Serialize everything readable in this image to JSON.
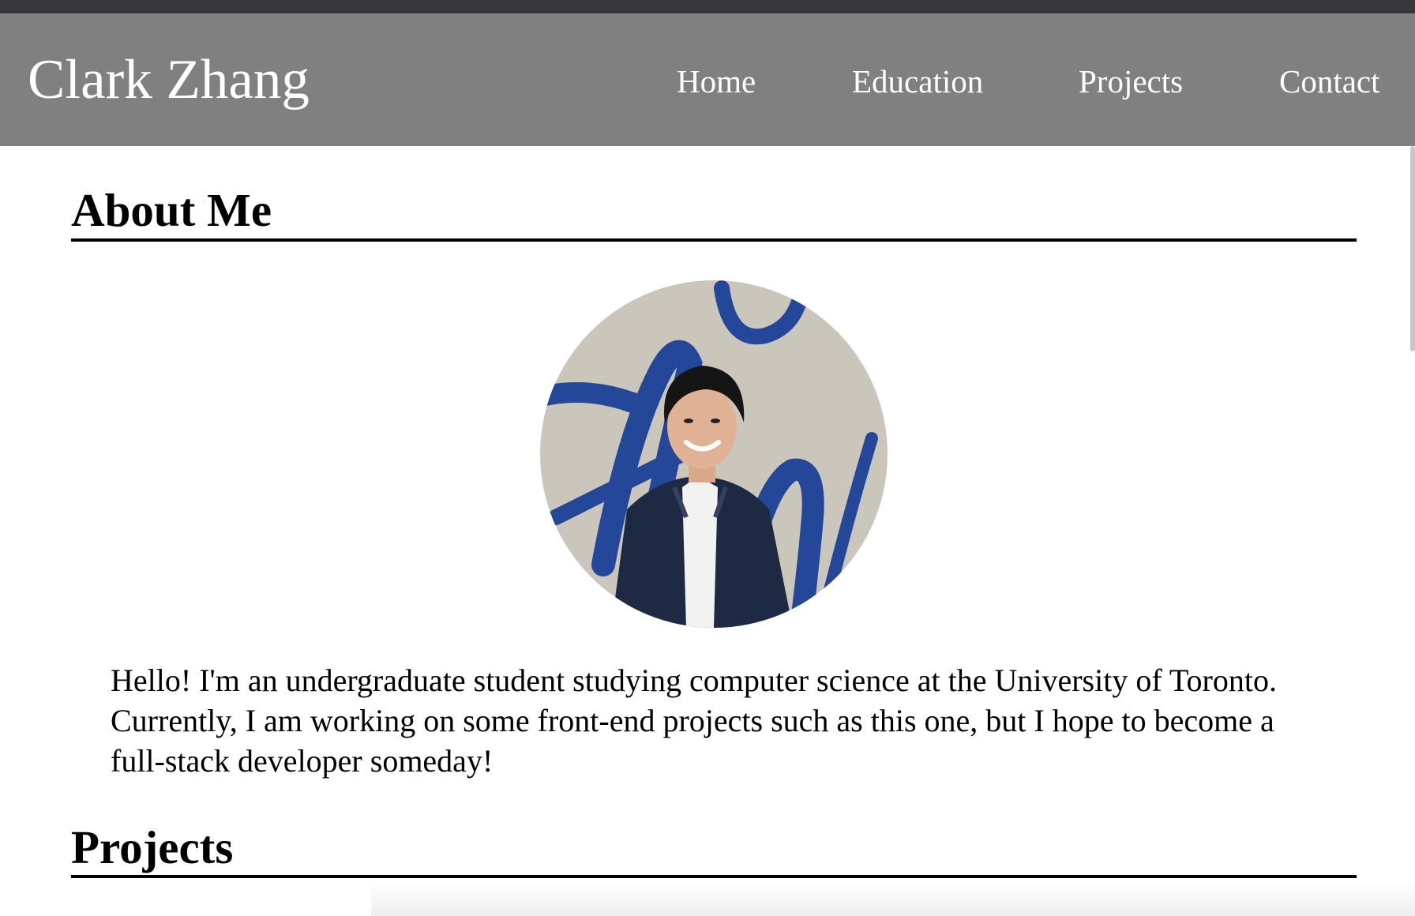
{
  "header": {
    "brand": "Clark Zhang",
    "nav": [
      {
        "label": "Home"
      },
      {
        "label": "Education"
      },
      {
        "label": "Projects"
      },
      {
        "label": "Contact"
      }
    ]
  },
  "about": {
    "heading": "About Me",
    "photo_icon": "profile-photo",
    "bio": "Hello! I'm an undergraduate student studying computer science at the University of Toronto. Currently, I am working on some front-end projects such as this one, but I hope to become a full-stack developer someday!"
  },
  "projects": {
    "heading": "Projects"
  },
  "colors": {
    "top_strip": "#36373c",
    "navbar": "#808080",
    "nav_text": "#ffffff",
    "heading": "#000000",
    "rule": "#000000"
  }
}
